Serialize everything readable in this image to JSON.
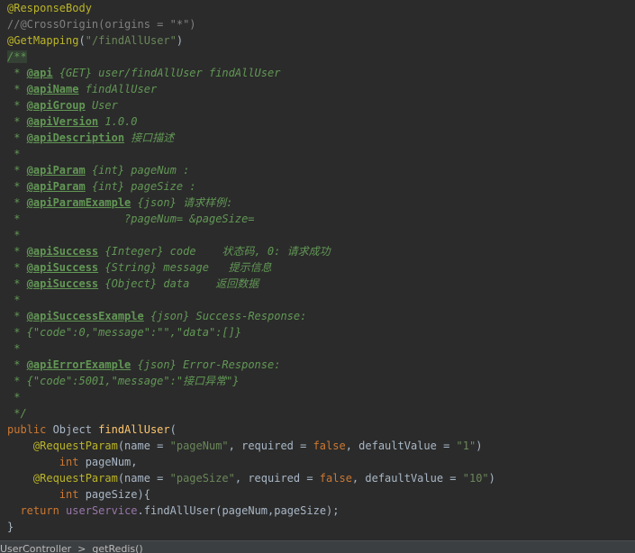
{
  "editor": {
    "lines": [
      {
        "segments": [
          {
            "text": "@ResponseBody",
            "cls": "annotation"
          }
        ]
      },
      {
        "segments": [
          {
            "text": "//@CrossOrigin(origins = \"*\")",
            "cls": "comment"
          }
        ]
      },
      {
        "segments": [
          {
            "text": "@GetMapping",
            "cls": "annotation"
          },
          {
            "text": "(",
            "cls": "plain"
          },
          {
            "text": "\"/findAllUser\"",
            "cls": "string"
          },
          {
            "text": ")",
            "cls": "plain"
          }
        ]
      },
      {
        "segments": [
          {
            "text": "/**",
            "cls": "doc ann-sel"
          }
        ]
      },
      {
        "segments": [
          {
            "text": " * ",
            "cls": "doc"
          },
          {
            "text": "@api",
            "cls": "doc-tag"
          },
          {
            "text": " {GET} user/findAllUser findAllUser",
            "cls": "doc"
          }
        ]
      },
      {
        "segments": [
          {
            "text": " * ",
            "cls": "doc"
          },
          {
            "text": "@apiName",
            "cls": "doc-tag"
          },
          {
            "text": " findAllUser",
            "cls": "doc"
          }
        ]
      },
      {
        "segments": [
          {
            "text": " * ",
            "cls": "doc"
          },
          {
            "text": "@apiGroup",
            "cls": "doc-tag"
          },
          {
            "text": " User",
            "cls": "doc"
          }
        ]
      },
      {
        "segments": [
          {
            "text": " * ",
            "cls": "doc"
          },
          {
            "text": "@apiVersion",
            "cls": "doc-tag"
          },
          {
            "text": " 1.0.0",
            "cls": "doc"
          }
        ]
      },
      {
        "segments": [
          {
            "text": " * ",
            "cls": "doc"
          },
          {
            "text": "@apiDescription",
            "cls": "doc-tag"
          },
          {
            "text": " 接口描述",
            "cls": "doc"
          }
        ]
      },
      {
        "segments": [
          {
            "text": " *",
            "cls": "doc"
          }
        ]
      },
      {
        "segments": [
          {
            "text": " * ",
            "cls": "doc"
          },
          {
            "text": "@apiParam",
            "cls": "doc-tag"
          },
          {
            "text": " {int} pageNum :",
            "cls": "doc"
          }
        ]
      },
      {
        "segments": [
          {
            "text": " * ",
            "cls": "doc"
          },
          {
            "text": "@apiParam",
            "cls": "doc-tag"
          },
          {
            "text": " {int} pageSize :",
            "cls": "doc"
          }
        ]
      },
      {
        "segments": [
          {
            "text": " * ",
            "cls": "doc"
          },
          {
            "text": "@apiParamExample",
            "cls": "doc-tag"
          },
          {
            "text": " {json} 请求样例:",
            "cls": "doc"
          }
        ]
      },
      {
        "segments": [
          {
            "text": " *                ?pageNum= &pageSize=",
            "cls": "doc"
          }
        ]
      },
      {
        "segments": [
          {
            "text": " *",
            "cls": "doc"
          }
        ]
      },
      {
        "segments": [
          {
            "text": " * ",
            "cls": "doc"
          },
          {
            "text": "@apiSuccess",
            "cls": "doc-tag"
          },
          {
            "text": " {Integer} code    状态码, 0: 请求成功",
            "cls": "doc"
          }
        ]
      },
      {
        "segments": [
          {
            "text": " * ",
            "cls": "doc"
          },
          {
            "text": "@apiSuccess",
            "cls": "doc-tag"
          },
          {
            "text": " {String} message   提示信息",
            "cls": "doc"
          }
        ]
      },
      {
        "segments": [
          {
            "text": " * ",
            "cls": "doc"
          },
          {
            "text": "@apiSuccess",
            "cls": "doc-tag"
          },
          {
            "text": " {Object} data    返回数据",
            "cls": "doc"
          }
        ]
      },
      {
        "segments": [
          {
            "text": " *",
            "cls": "doc"
          }
        ]
      },
      {
        "segments": [
          {
            "text": " * ",
            "cls": "doc"
          },
          {
            "text": "@apiSuccessExample",
            "cls": "doc-tag"
          },
          {
            "text": " {json} Success-Response:",
            "cls": "doc"
          }
        ]
      },
      {
        "segments": [
          {
            "text": " * {\"code\":0,\"message\":\"\",\"data\":[]}",
            "cls": "doc"
          }
        ]
      },
      {
        "segments": [
          {
            "text": " *",
            "cls": "doc"
          }
        ]
      },
      {
        "segments": [
          {
            "text": " * ",
            "cls": "doc"
          },
          {
            "text": "@apiErrorExample",
            "cls": "doc-tag"
          },
          {
            "text": " {json} Error-Response:",
            "cls": "doc"
          }
        ]
      },
      {
        "segments": [
          {
            "text": " * {\"code\":5001,\"message\":\"接口异常\"}",
            "cls": "doc"
          }
        ]
      },
      {
        "segments": [
          {
            "text": " *",
            "cls": "doc"
          }
        ]
      },
      {
        "segments": [
          {
            "text": " */",
            "cls": "doc"
          }
        ]
      },
      {
        "segments": [
          {
            "text": "public",
            "cls": "keyword"
          },
          {
            "text": " Object ",
            "cls": "plain"
          },
          {
            "text": "findAllUser",
            "cls": "method"
          },
          {
            "text": "(",
            "cls": "plain"
          }
        ]
      },
      {
        "segments": [
          {
            "text": "    ",
            "cls": "plain"
          },
          {
            "text": "@RequestParam",
            "cls": "annotation"
          },
          {
            "text": "(name = ",
            "cls": "plain"
          },
          {
            "text": "\"pageNum\"",
            "cls": "string"
          },
          {
            "text": ", required = ",
            "cls": "plain"
          },
          {
            "text": "false",
            "cls": "keyword"
          },
          {
            "text": ", defaultValue = ",
            "cls": "plain"
          },
          {
            "text": "\"1\"",
            "cls": "string"
          },
          {
            "text": ")",
            "cls": "plain"
          }
        ]
      },
      {
        "segments": [
          {
            "text": "        ",
            "cls": "plain"
          },
          {
            "text": "int",
            "cls": "keyword"
          },
          {
            "text": " pageNum,",
            "cls": "plain"
          }
        ]
      },
      {
        "segments": [
          {
            "text": "    ",
            "cls": "plain"
          },
          {
            "text": "@RequestParam",
            "cls": "annotation"
          },
          {
            "text": "(name = ",
            "cls": "plain"
          },
          {
            "text": "\"pageSize\"",
            "cls": "string"
          },
          {
            "text": ", required = ",
            "cls": "plain"
          },
          {
            "text": "false",
            "cls": "keyword"
          },
          {
            "text": ", defaultValue = ",
            "cls": "plain"
          },
          {
            "text": "\"10\"",
            "cls": "string"
          },
          {
            "text": ")",
            "cls": "plain"
          }
        ]
      },
      {
        "segments": [
          {
            "text": "        ",
            "cls": "plain"
          },
          {
            "text": "int",
            "cls": "keyword"
          },
          {
            "text": " pageSize){",
            "cls": "plain"
          }
        ]
      },
      {
        "segments": [
          {
            "text": "  ",
            "cls": "plain"
          },
          {
            "text": "return",
            "cls": "keyword"
          },
          {
            "text": " ",
            "cls": "plain"
          },
          {
            "text": "userService",
            "cls": "field"
          },
          {
            "text": ".findAllUser(pageNum,pageSize);",
            "cls": "plain"
          }
        ]
      },
      {
        "segments": [
          {
            "text": "}",
            "cls": "plain"
          }
        ]
      }
    ]
  },
  "bottom_strip": {
    "text": "UserController  >  getRedis()"
  }
}
